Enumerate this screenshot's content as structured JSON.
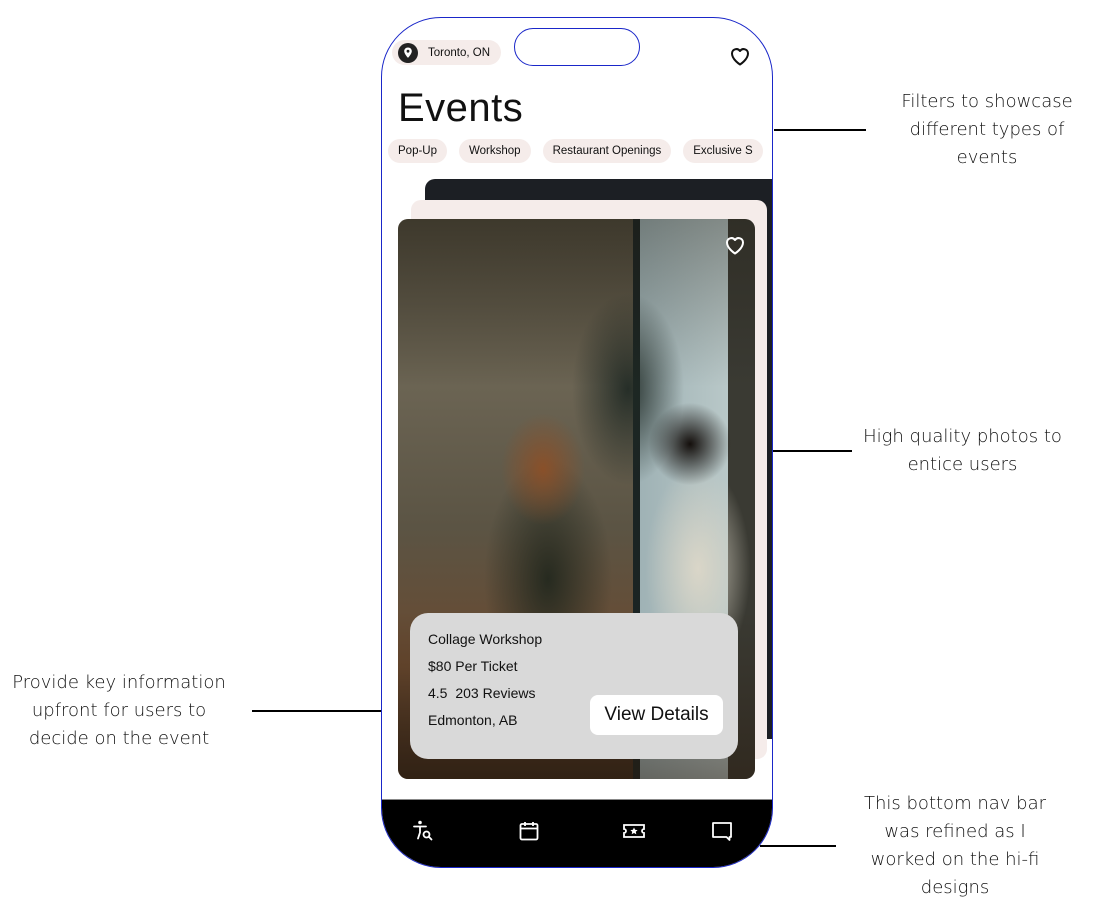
{
  "phone": {
    "location": "Toronto, ON",
    "title": "Events",
    "filters": [
      "Pop-Up",
      "Workshop",
      "Restaurant Openings",
      "Exclusive S"
    ],
    "event": {
      "name": "Collage Workshop",
      "price": "$80 Per Ticket",
      "rating": "4.5",
      "reviews": "203 Reviews",
      "location": "Edmonton, AB",
      "cta": "View Details"
    },
    "nav": [
      {
        "icon": "explore-person-search-icon"
      },
      {
        "icon": "calendar-icon"
      },
      {
        "icon": "ticket-star-icon"
      },
      {
        "icon": "chat-icon"
      }
    ]
  },
  "annotations": {
    "filters": "Filters to showcase different types of events",
    "photos": "High quality photos to entice users",
    "info": "Provide key information upfront for users to decide on the event",
    "navbar": "This bottom nav bar was refined as I worked on the hi-fi designs"
  },
  "colors": {
    "chip_bg": "#f5ecea",
    "frame_outline": "#1a27c9",
    "nav_bg": "#000000",
    "info_card_bg": "#d9d9d9"
  }
}
